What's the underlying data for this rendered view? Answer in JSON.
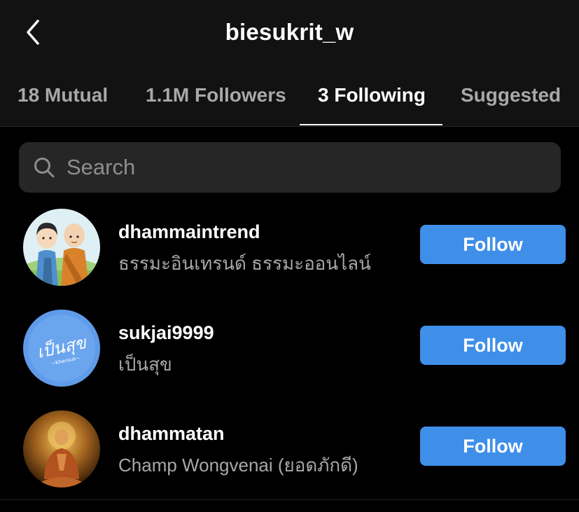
{
  "header": {
    "back_icon": "chevron-left-icon",
    "title": "biesukrit_w"
  },
  "tabs": [
    {
      "label": "18 Mutual",
      "active": false
    },
    {
      "label": "1.1M Followers",
      "active": false
    },
    {
      "label": "3 Following",
      "active": true
    },
    {
      "label": "Suggested",
      "active": false
    }
  ],
  "search": {
    "placeholder": "Search",
    "value": "",
    "icon": "search-icon"
  },
  "accounts": [
    {
      "username": "dhammaintrend",
      "full_name": "ธรรมะอินเทรนด์ ธรรมะออนไลน์",
      "button_label": "Follow"
    },
    {
      "username": "sukjai9999",
      "full_name": "เป็นสุข",
      "button_label": "Follow",
      "avatar_text": "เป็นสุข",
      "avatar_subtext": "~Khensuk~"
    },
    {
      "username": "dhammatan",
      "full_name": "Champ Wongvenai (ยอดภักดี)",
      "button_label": "Follow"
    }
  ],
  "colors": {
    "background": "#000000",
    "header_background": "#121212",
    "search_background": "#262626",
    "follow_button": "#3f8fe9",
    "secondary_text": "#a8a8a8"
  }
}
